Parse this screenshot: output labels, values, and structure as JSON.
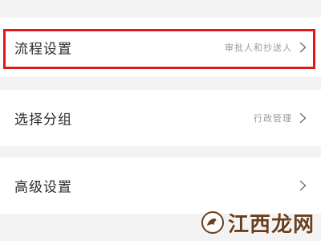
{
  "settings": {
    "items": [
      {
        "label": "流程设置",
        "value": "审批人和抄送人"
      },
      {
        "label": "选择分组",
        "value": "行政管理"
      },
      {
        "label": "高级设置",
        "value": ""
      }
    ]
  },
  "watermark": {
    "text": "江西龙网"
  },
  "colors": {
    "highlight": "#e01818",
    "label": "#2b2b2b",
    "value": "#9a9a9a",
    "background": "#f3f3f3",
    "watermark": "#6a3f1e"
  },
  "icons": {
    "row_arrow": "chevron-right-icon",
    "watermark_logo": "dragon-logo-icon"
  }
}
